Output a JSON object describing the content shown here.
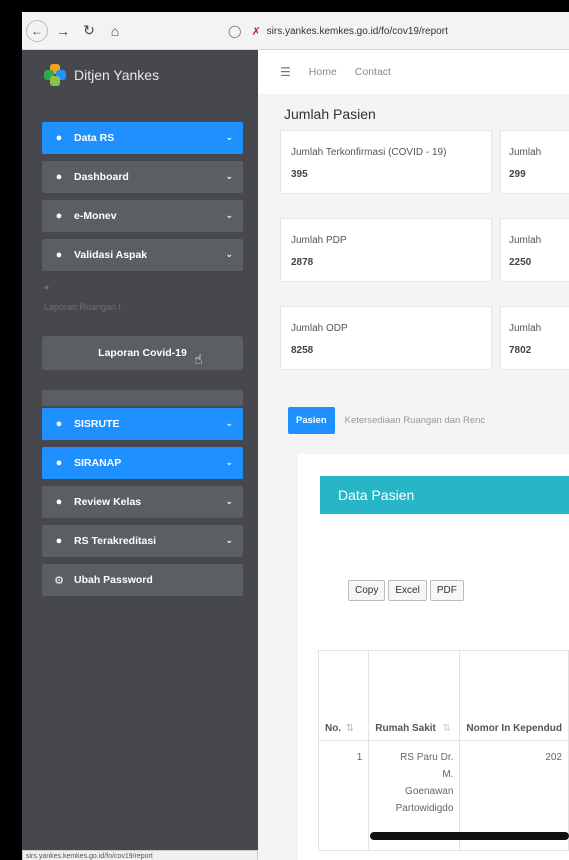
{
  "browser": {
    "url": "sirs.yankes.kemkes.go.id/fo/cov19/report",
    "status_url": "sirs.yankes.kemkes.go.id/fo/cov19/report"
  },
  "brand": {
    "name": "Ditjen Yankes"
  },
  "sidebar": {
    "items": [
      {
        "label": "Data RS"
      },
      {
        "label": "Dashboard"
      },
      {
        "label": "e-Monev"
      },
      {
        "label": "Validasi Aspak"
      },
      {
        "label": "SISRUTE"
      },
      {
        "label": "SIRANAP"
      },
      {
        "label": "Review Kelas"
      },
      {
        "label": "RS Terakreditasi"
      },
      {
        "label": "Ubah Password"
      }
    ],
    "ghost_label": "Laporan Ruangan I",
    "sub_button": "Laporan Covid-19"
  },
  "topnav": {
    "home": "Home",
    "contact": "Contact"
  },
  "page_title": "Jumlah Pasien",
  "cards": [
    {
      "label": "Jumlah Terkonfirmasi (COVID - 19)",
      "value": "395"
    },
    {
      "label": "Jumlah",
      "value": "299"
    },
    {
      "label": "Jumlah PDP",
      "value": "2878"
    },
    {
      "label": "Jumlah",
      "value": "2250"
    },
    {
      "label": "Jumlah ODP",
      "value": "8258"
    },
    {
      "label": "Jumlah",
      "value": "7802"
    }
  ],
  "tabs": {
    "active": "Pasien",
    "other": "Ketersediaan Ruangan dan Renc"
  },
  "panel": {
    "title": "Data Pasien",
    "buttons": [
      "Copy",
      "Excel",
      "PDF"
    ],
    "columns": [
      "No.",
      "Rumah Sakit",
      "Nomor In Kependud"
    ],
    "rows": [
      {
        "no": "1",
        "rs_lines": [
          "RS Paru Dr.",
          "M.",
          "Goenawan",
          "Partowidigdo"
        ],
        "nik": "202"
      }
    ]
  }
}
